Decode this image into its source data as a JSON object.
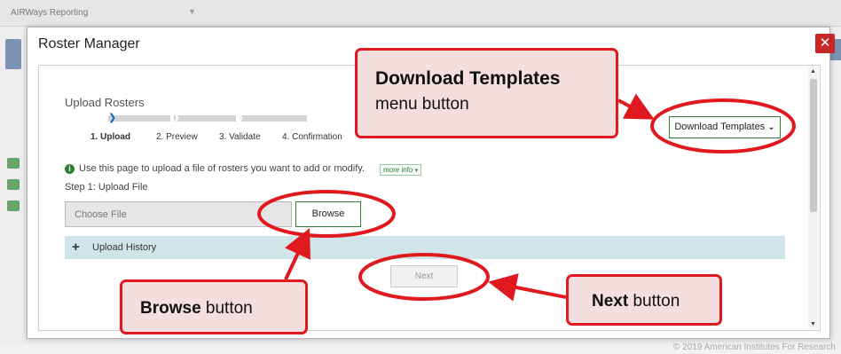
{
  "app": {
    "title": "AIRWays Reporting",
    "footer_copyright": "© 2019 American Institutes For Research"
  },
  "modal": {
    "title": "Roster Manager",
    "close_icon": "close-icon"
  },
  "upload": {
    "heading": "Upload Rosters",
    "steps": [
      {
        "label": "1. Upload",
        "active": true
      },
      {
        "label": "2. Preview",
        "active": false
      },
      {
        "label": "3. Validate",
        "active": false
      },
      {
        "label": "4. Confirmation",
        "active": false
      }
    ],
    "info_text": "Use this page to upload a file of rosters you want to add or modify.",
    "more_info": "more info",
    "step1_label": "Step 1: Upload File",
    "file_placeholder": "Choose File",
    "browse_label": "Browse",
    "history_label": "Upload History",
    "next_label": "Next",
    "download_templates_label": "Download Templates"
  },
  "callouts": {
    "download": {
      "bold": "Download Templates",
      "rest": "menu button"
    },
    "browse": {
      "bold": "Browse",
      "rest": " button"
    },
    "next": {
      "bold": "Next",
      "rest": " button"
    }
  },
  "colors": {
    "accent_green": "#2e7d32",
    "callout_red": "#e0191f",
    "callout_fill": "#f4dede",
    "history_bar": "#cfe5e9",
    "close_red": "#c62828"
  }
}
